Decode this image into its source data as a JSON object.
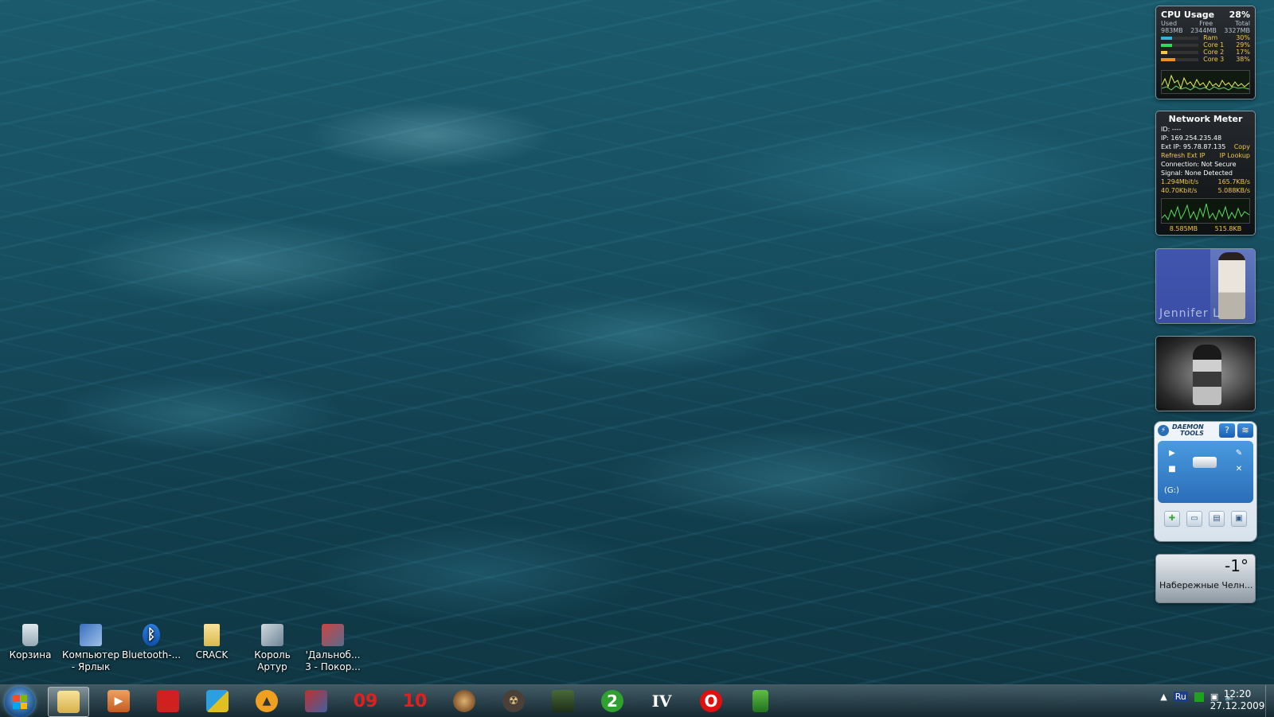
{
  "desktop_icons": [
    {
      "label": "Корзина"
    },
    {
      "label": "Компьютер - Ярлык"
    },
    {
      "label": "Bluetooth-..."
    },
    {
      "label": "CRACK"
    },
    {
      "label": "Король Артур"
    },
    {
      "label": "'Дальноб... 3 - Покор..."
    }
  ],
  "cpu_gadget": {
    "title": "CPU Usage",
    "percent": "28%",
    "headers": {
      "used": "Used",
      "free": "Free",
      "total": "Total"
    },
    "used": "983MB",
    "free": "2344MB",
    "total": "3327MB",
    "rows": [
      {
        "label": "Ram",
        "value": "30%"
      },
      {
        "label": "Core 1",
        "value": "29%"
      },
      {
        "label": "Core 2",
        "value": "17%"
      },
      {
        "label": "Core 3",
        "value": "38%"
      }
    ]
  },
  "network_gadget": {
    "title": "Network Meter",
    "id": "ID: ----",
    "ip": "IP: 169.254.235.48",
    "ext_ip": "Ext IP: 95.78.87.135",
    "copy": "Copy",
    "refresh": "Refresh Ext IP",
    "lookup": "IP Lookup",
    "connection": "Connection: Not Secure",
    "signal": "Signal: None Detected",
    "up_speed": "1.294Mbit/s",
    "up_rate": "165.7KB/s",
    "down_speed": "40.70Kbit/s",
    "down_rate": "5.088KB/s",
    "total_up": "8.585MB",
    "total_down": "515.8KB"
  },
  "photo_gadget": {
    "caption": "Jennifer L"
  },
  "daemon_tools": {
    "brand_line1": "DAEMON",
    "brand_line2": "TOOLS",
    "help": "?",
    "drive_label": "(G:)"
  },
  "weather": {
    "temperature": "-1°",
    "city": "Набережные Челн..."
  },
  "taskbar": {
    "apps": [
      {
        "name": "explorer",
        "text": ""
      },
      {
        "name": "media-player",
        "text": ""
      },
      {
        "name": "monitor",
        "text": ""
      },
      {
        "name": "boxes",
        "text": ""
      },
      {
        "name": "aimp",
        "text": ""
      },
      {
        "name": "game",
        "text": ""
      },
      {
        "name": "app-09",
        "text": "09"
      },
      {
        "name": "app-10",
        "text": "10"
      },
      {
        "name": "game-face",
        "text": ""
      },
      {
        "name": "stalker",
        "text": ""
      },
      {
        "name": "soldier",
        "text": ""
      },
      {
        "name": "app-2",
        "text": "2"
      },
      {
        "name": "gta-iv",
        "text": "IV"
      },
      {
        "name": "opera",
        "text": "O"
      },
      {
        "name": "tool",
        "text": ""
      }
    ],
    "lang": "Ru",
    "time": "12:20",
    "date": "27.12.2009"
  }
}
